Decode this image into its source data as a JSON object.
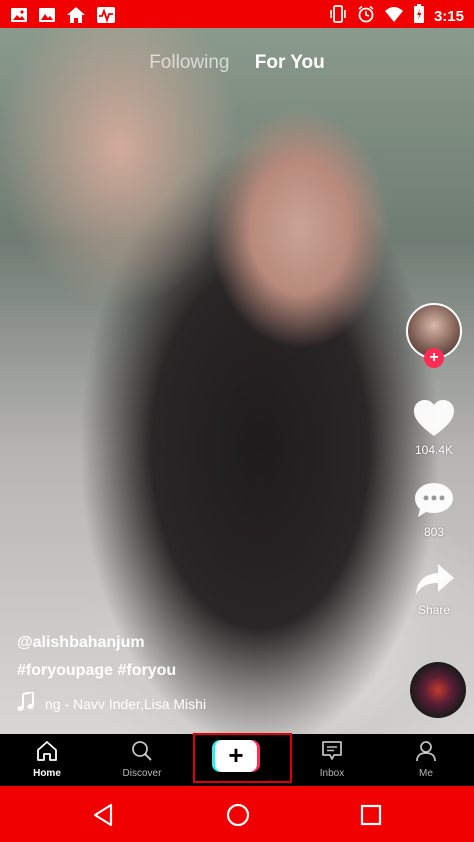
{
  "status_bar": {
    "left_icons": [
      "image-icon",
      "photo-icon",
      "home-icon",
      "activity-icon"
    ],
    "right_icons": [
      "vibrate-icon",
      "alarm-icon",
      "wifi-icon",
      "battery-icon"
    ],
    "time": "3:15"
  },
  "top_tabs": {
    "following": "Following",
    "for_you": "For You",
    "active": "For You"
  },
  "actions": {
    "like_count": "104.4K",
    "comment_count": "803",
    "share_label": "Share"
  },
  "caption": {
    "username": "@alishbahanjum",
    "hashtags": "#foryoupage #foryou",
    "music": "ng - Navv Inder,Lisa Mishi"
  },
  "bottom_nav": {
    "home": "Home",
    "discover": "Discover",
    "create": "+",
    "inbox": "Inbox",
    "me": "Me"
  },
  "colors": {
    "status_bar": "#f00000",
    "accent_red": "#fe2c55",
    "accent_cyan": "#25f4ee",
    "highlight_box": "#e00000"
  }
}
